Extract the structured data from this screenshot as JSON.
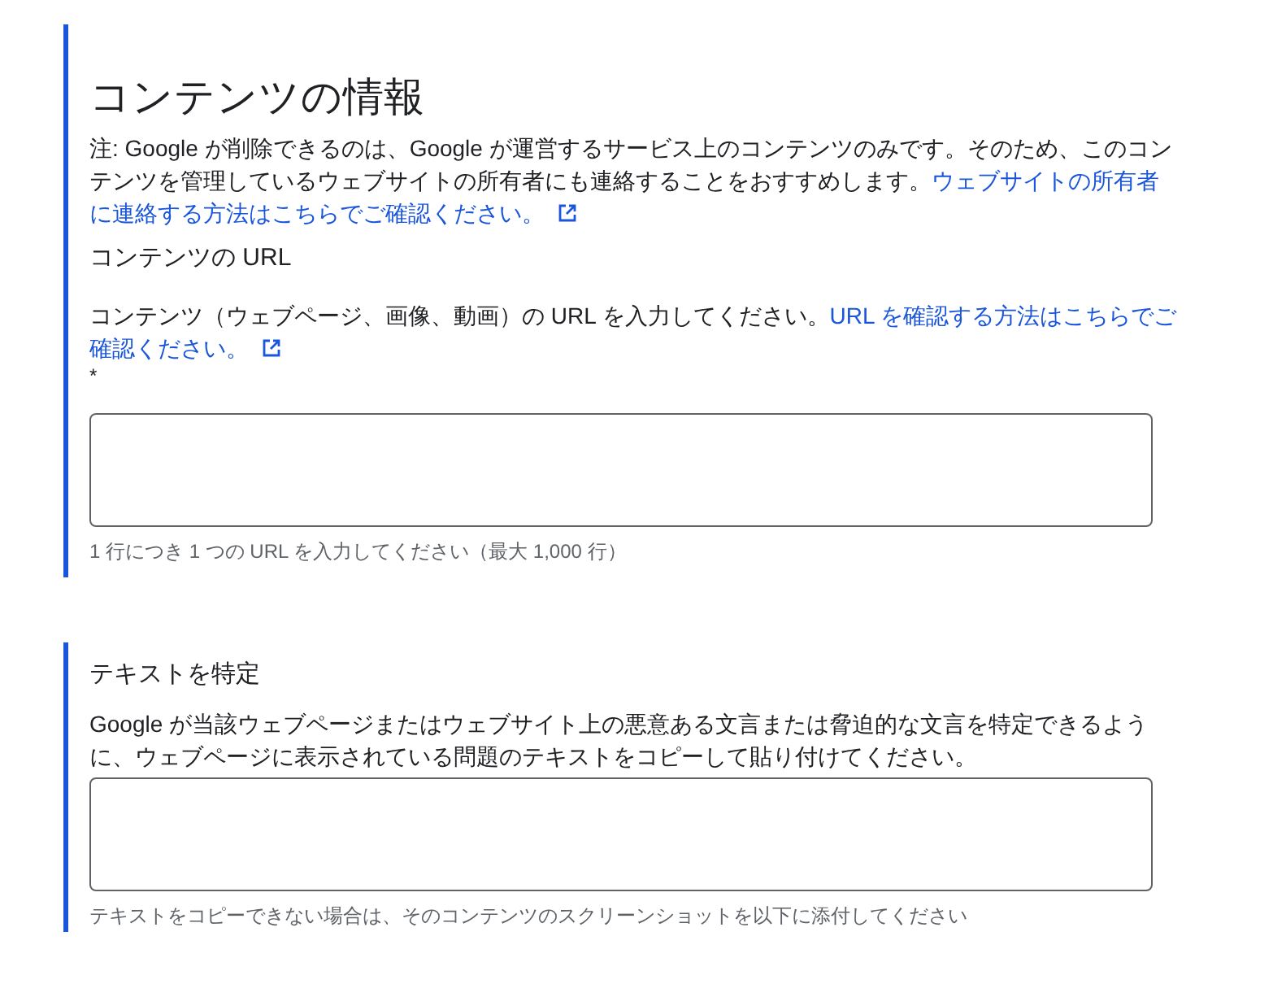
{
  "content_info": {
    "title": "コンテンツの情報",
    "note": "注: Google が削除できるのは、Google が運営するサービス上のコンテンツのみです。そのため、このコンテンツを管理しているウェブサイトの所有者にも連絡することをおすすめします。",
    "note_link": [
      "ウェブサイトの所有者",
      "に連絡する方法はこちらでご確認ください。"
    ],
    "url_field": {
      "label": "コンテンツの URL",
      "description": "コンテンツ（ウェブページ、画像、動画）の URL を入力してください。",
      "description_link": [
        "URL を確認する方法はこちらでご",
        "確認ください。"
      ],
      "required_mark": "*",
      "helper": "1 行につき 1 つの URL を入力してください（最大 1,000 行）"
    }
  },
  "text_section": {
    "label": "テキストを特定",
    "description": "Google が当該ウェブページまたはウェブサイト上の悪意ある文言または脅迫的な文言を特定できるように、ウェブページに表示されている問題のテキストをコピーして貼り付けてください。",
    "helper": "テキストをコピーできない場合は、そのコンテンツのスクリーンショットを以下に添付してください"
  }
}
